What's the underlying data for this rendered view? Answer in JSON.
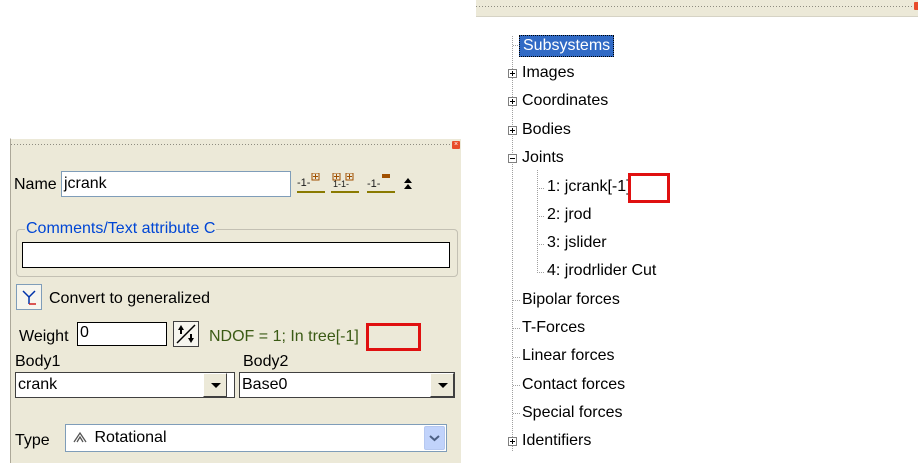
{
  "left_panel": {
    "name_label": "Name",
    "name_value": "jcrank",
    "comments_label": "Comments/Text attribute C",
    "comments_value": "",
    "convert_label": "Convert to generalized",
    "weight_label": "Weight",
    "weight_value": "0",
    "ndof_text": "NDOF = 1; In tree",
    "ndof_highlight": "[-1]",
    "body1_label": "Body1",
    "body1_value": "crank",
    "body2_label": "Body2",
    "body2_value": "Base0",
    "type_label": "Type",
    "type_value": "Rotational"
  },
  "tree": {
    "root": "Subsystems",
    "items": [
      {
        "label": "Images",
        "expander": "plus"
      },
      {
        "label": "Coordinates",
        "expander": "plus"
      },
      {
        "label": "Bodies",
        "expander": "plus"
      },
      {
        "label": "Joints",
        "expander": "minus"
      },
      {
        "label": "1: jcrank",
        "suffix": "[-1]"
      },
      {
        "label": "2: jrod"
      },
      {
        "label": "3: jslider"
      },
      {
        "label": "4: jrodrlider Cut"
      },
      {
        "label": "Bipolar forces"
      },
      {
        "label": "T-Forces"
      },
      {
        "label": "Linear forces"
      },
      {
        "label": "Contact forces"
      },
      {
        "label": "Special forces"
      },
      {
        "label": "Identifiers",
        "expander": "plus"
      }
    ]
  },
  "colors": {
    "panel_bg": "#ece9d8",
    "selection": "#316ac5",
    "highlight_box": "#e01010",
    "group_label": "#0046d5",
    "ndof_text": "#3a5a14"
  },
  "icons": {
    "add": "add-joint-icon",
    "add_multiple": "add-multiple-icon",
    "remove": "remove-joint-icon",
    "collapse": "collapse-up-icon",
    "convert": "convert-coordinates-icon",
    "spin": "spin-icon",
    "rotational": "rotational-joint-icon"
  }
}
